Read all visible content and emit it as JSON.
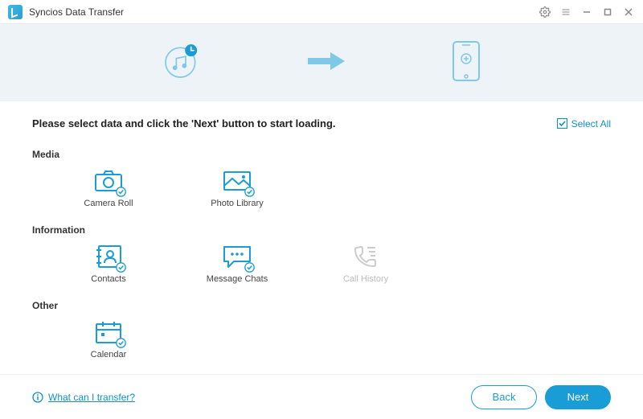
{
  "titlebar": {
    "app_title": "Syncios Data Transfer"
  },
  "main": {
    "instruction": "Please select data and click the 'Next' button to start loading.",
    "select_all_label": "Select All",
    "sections": {
      "media": {
        "title": "Media",
        "items": [
          {
            "label": "Camera Roll",
            "icon": "camera-roll-icon",
            "enabled": true
          },
          {
            "label": "Photo Library",
            "icon": "photo-library-icon",
            "enabled": true
          }
        ]
      },
      "information": {
        "title": "Information",
        "items": [
          {
            "label": "Contacts",
            "icon": "contacts-icon",
            "enabled": true
          },
          {
            "label": "Message Chats",
            "icon": "message-chats-icon",
            "enabled": true
          },
          {
            "label": "Call History",
            "icon": "call-history-icon",
            "enabled": false
          }
        ]
      },
      "other": {
        "title": "Other",
        "items": [
          {
            "label": "Calendar",
            "icon": "calendar-icon",
            "enabled": true
          }
        ]
      }
    }
  },
  "footer": {
    "help_label": "What can I transfer?",
    "back_label": "Back",
    "next_label": "Next"
  },
  "colors": {
    "accent": "#1a9dd6",
    "accent_light": "#7fc8e8",
    "disabled": "#cccccc"
  }
}
